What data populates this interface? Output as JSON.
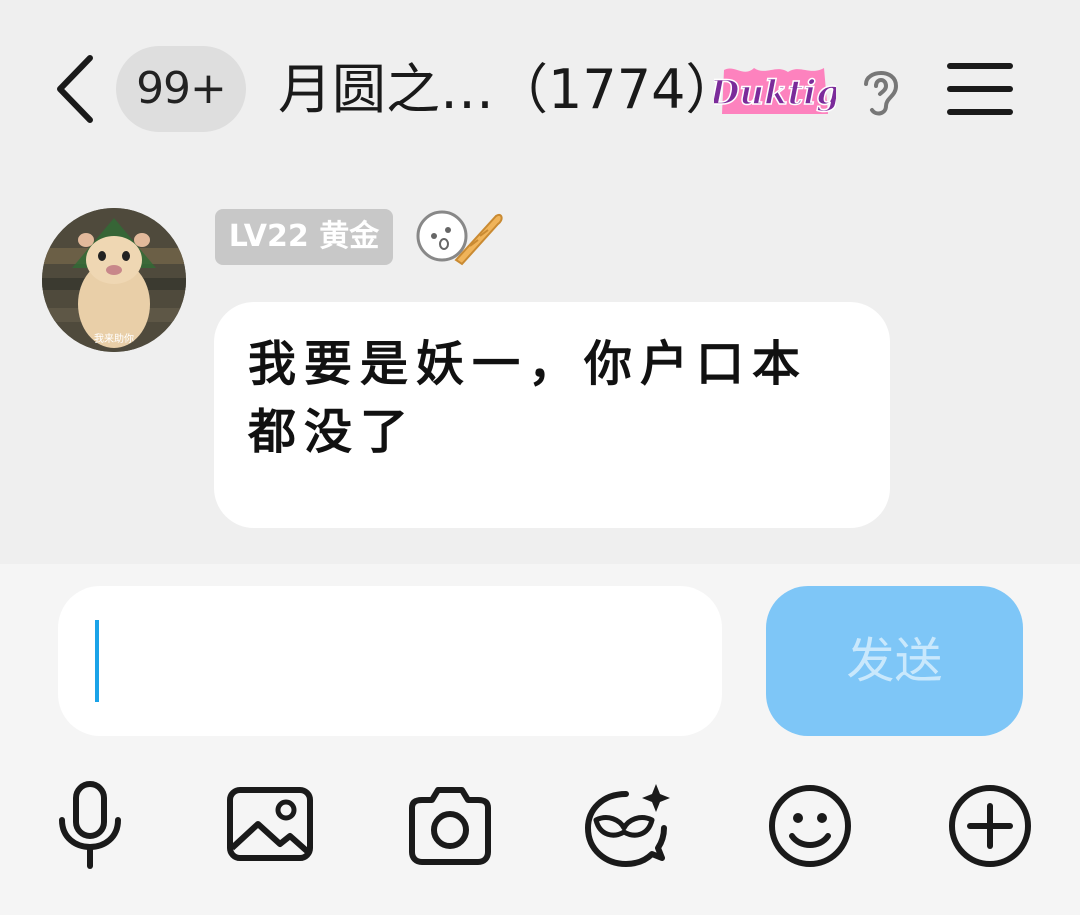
{
  "header": {
    "unread_count": "99+",
    "title": "月圆之…（1774）",
    "brand_sticker_text": "Duktig"
  },
  "message": {
    "level_badge": "LV22 黄金",
    "text": "我要是妖一，你户口本都没了",
    "avatar_caption": "我来助你"
  },
  "composer": {
    "input_value": "",
    "send_label": "发送"
  },
  "colors": {
    "page_background": "#efefef",
    "bubble": "#ffffff",
    "send_button": "#7ec6f7",
    "send_text": "#c9e8fc",
    "caret": "#1aa3e8",
    "badge": "#c8c8c8"
  },
  "toolbar_icons": [
    "microphone-icon",
    "image-icon",
    "camera-icon",
    "mask-effect-icon",
    "emoji-icon",
    "plus-icon"
  ]
}
